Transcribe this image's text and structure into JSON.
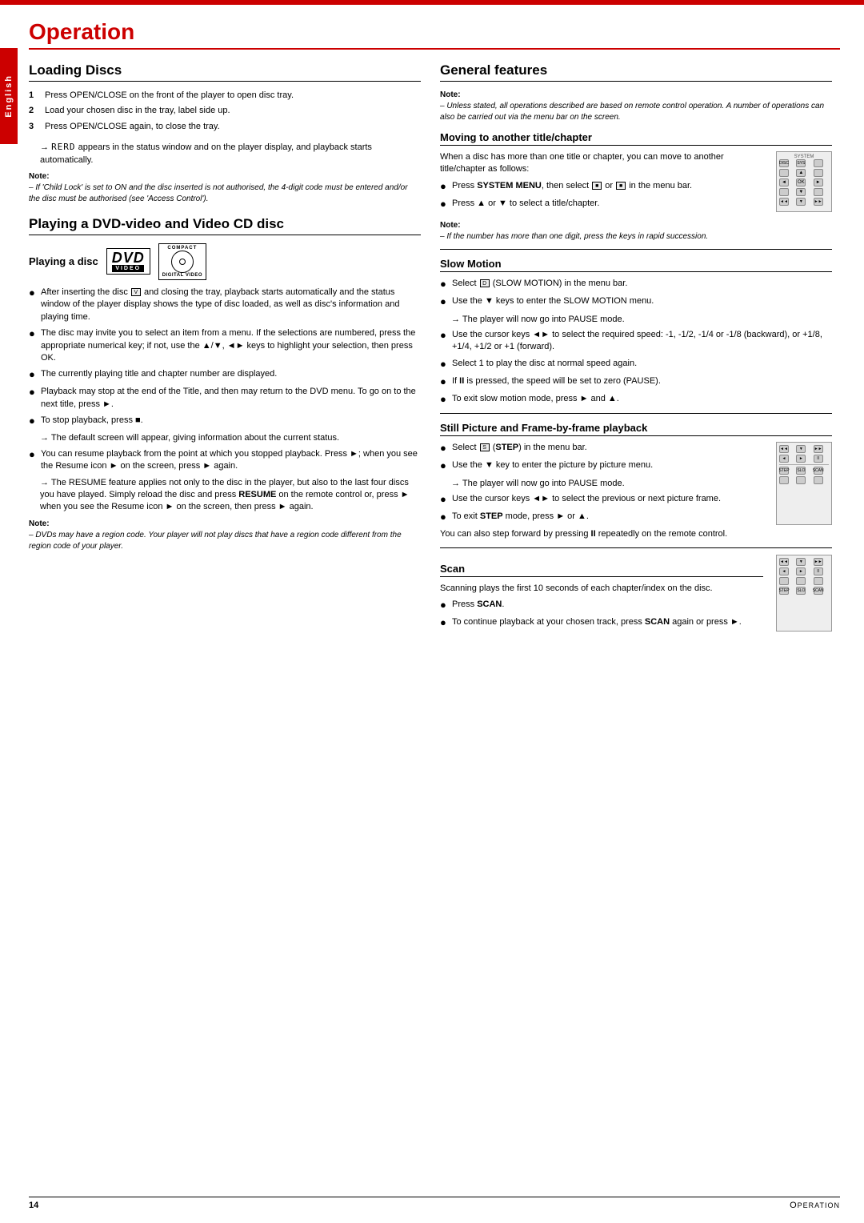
{
  "page": {
    "top_bar_color": "#cc0000",
    "side_label": "English",
    "main_title": "Operation",
    "footer": {
      "page_number": "14",
      "title": "Operation"
    }
  },
  "loading_discs": {
    "title": "Loading Discs",
    "steps": [
      {
        "num": "1",
        "text": "Press OPEN/CLOSE on the front of the player to open disc tray."
      },
      {
        "num": "2",
        "text": "Load your chosen disc in the tray, label side up."
      },
      {
        "num": "3",
        "text": "Press OPEN/CLOSE again, to close the tray."
      }
    ],
    "read_arrow": "→",
    "read_text": " appears in the status window and on the player display, and playback starts automatically.",
    "note_label": "Note:",
    "note_text": "– If 'Child Lock' is set to ON and the disc inserted is not authorised, the 4-digit code must be entered and/or the disc must be authorised (see 'Access Control')."
  },
  "playing_dvd": {
    "title": "Playing a DVD-video and Video CD disc",
    "playing_disc_label": "Playing a disc",
    "dvd_label": "DVD",
    "video_label": "VIDEO",
    "compact_label": "COMPACT",
    "disc_label": "DISC",
    "digital_video_label": "DIGITAL VIDEO",
    "bullets": [
      "After inserting the disc and closing the tray, playback starts automatically and the status window of the player display shows the type of disc loaded, as well as disc's information and playing time.",
      "The disc may invite you to select an item from a menu. If the selections are numbered, press the appropriate numerical key; if not, use the ▲/▼, ◄► keys to highlight your selection, then press OK.",
      "The currently playing title and chapter number are displayed.",
      "Playback may stop at the end of the Title, and then may return to the DVD menu. To go on to the next title, press ►.",
      "To stop playback, press ■."
    ],
    "default_screen_arrow": "→",
    "default_screen_text": "The default screen will appear, giving information about the current status.",
    "resume_text": "You can resume playback from the point at which you stopped playback. Press ►; when you see the Resume icon ► on the screen, press ► again.",
    "resume_arrow": "→",
    "resume_feature_text": "The RESUME feature applies not only to the disc in the player, but also to the last four discs you have played. Simply reload the disc and press RESUME on the remote control or, press ► when you see the Resume icon ► on the screen, then press ► again.",
    "note_label": "Note:",
    "note_text": "– DVDs may have a region code. Your player will not play discs that have a region code different from the region code of your player."
  },
  "general_features": {
    "title": "General features",
    "note_label": "Note:",
    "note_text": "– Unless stated, all operations described are based on remote control operation. A number of operations can also be carried out via the menu bar on the screen."
  },
  "moving_title": {
    "title": "Moving to another title/chapter",
    "intro": "When a disc has more than one title or chapter, you can move to another title/chapter as follows:",
    "bullets": [
      "Press SYSTEM MENU, then select  or  in the menu bar.",
      "Press ▲ or ▼ to select a title/chapter."
    ],
    "note_label": "Note:",
    "note_text": "– If the number has more than one digit, press the keys in rapid succession."
  },
  "slow_motion": {
    "title": "Slow Motion",
    "bullets": [
      "Select  (SLOW MOTION) in the menu bar.",
      "Use the ▼ keys to enter the SLOW MOTION menu.",
      "Use the cursor keys ◄► to select the required speed: -1, -1/2, -1/4 or -1/8 (backward), or +1/8, +1/4, +1/2 or +1 (forward).",
      "Select 1 to play the disc at normal speed again.",
      "If II is pressed, the speed will be set to zero (PAUSE).",
      "To exit slow motion mode, press ► and ▲."
    ],
    "arrow_text": "The player will now go into PAUSE mode."
  },
  "still_picture": {
    "title": "Still Picture and Frame-by-frame playback",
    "bullets": [
      "Select  (STEP) in the menu bar.",
      "Use the ▼ key to enter the picture by picture menu.",
      "Use the cursor keys ◄► to select the previous or next picture frame.",
      "To exit STEP mode, press ► or ▲."
    ],
    "arrow_pause": "The player will now go into PAUSE mode.",
    "extra_text": "You can also step forward by pressing II repeatedly on the remote control."
  },
  "scan": {
    "title": "Scan",
    "intro": "Scanning plays the first 10 seconds of each chapter/index on the disc.",
    "bullets": [
      "Press SCAN.",
      "To continue playback at your chosen track, press SCAN again or press ►."
    ]
  }
}
